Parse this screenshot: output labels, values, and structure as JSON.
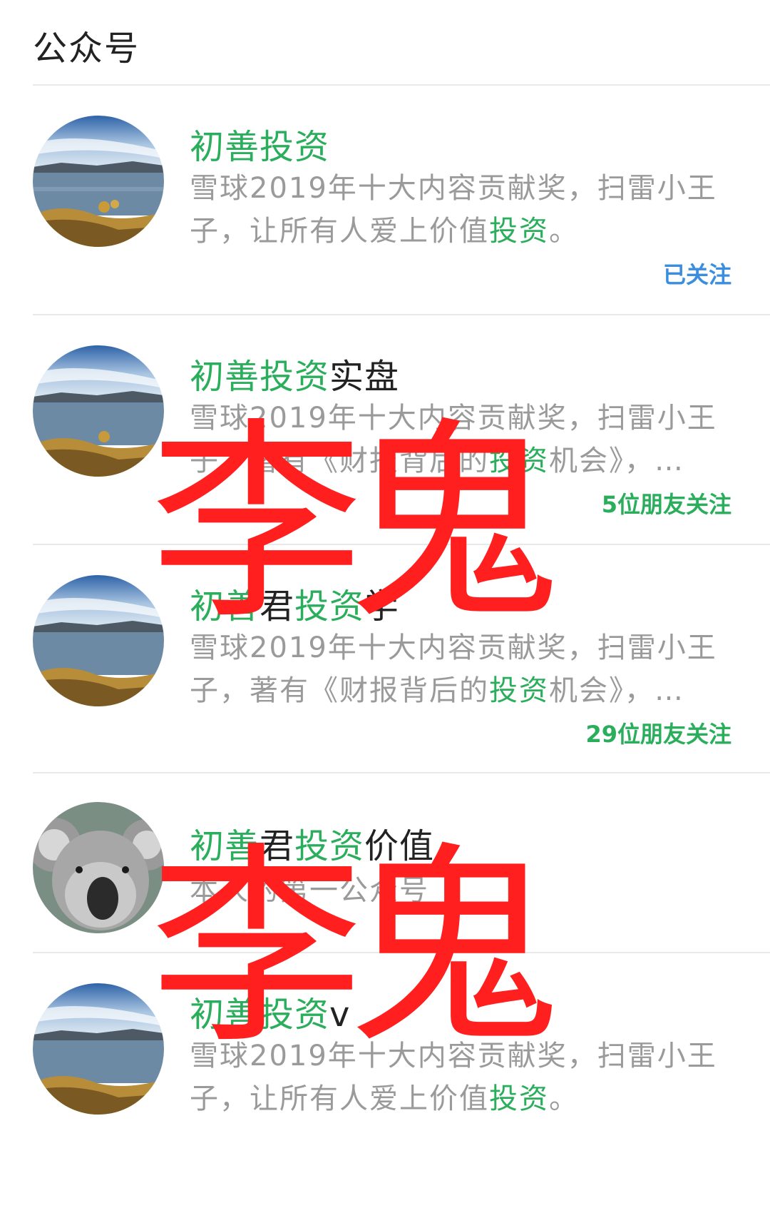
{
  "header": {
    "title": "公众号"
  },
  "accounts": [
    {
      "name_hl": "初善投资",
      "name_rest": "",
      "desc_pre": "雪球2019年十大内容贡献奖，扫雷小王子，让所有人爱上价值",
      "desc_hl": "投资",
      "desc_post": "。",
      "status": "已关注",
      "status_color": "#3b8de0",
      "avatar": "lake-landscape-avatar"
    },
    {
      "name_hl": "初善投资",
      "name_rest": "实盘",
      "desc_pre": "雪球2019年十大内容贡献奖，扫雷小王子，著有《财报背后的",
      "desc_hl": "投资",
      "desc_post": "机会》，…",
      "status": "5位朋友关注",
      "status_color": "#2aae5c",
      "avatar": "lake-landscape-avatar"
    },
    {
      "name_hl": "初善",
      "name_mid": "君",
      "name_hl2": "投资",
      "name_rest": "学",
      "desc_pre": "雪球2019年十大内容贡献奖，扫雷小王子，著有《财报背后的",
      "desc_hl": "投资",
      "desc_post": "机会》，…",
      "status": "29位朋友关注",
      "status_color": "#2aae5c",
      "avatar": "lake-landscape-avatar"
    },
    {
      "name_hl": "初善",
      "name_mid": "君",
      "name_hl2": "投资",
      "name_rest": "价值",
      "desc_pre": "本人的第一公众号",
      "desc_hl": "",
      "desc_post": "",
      "status": "",
      "avatar": "koala-avatar"
    },
    {
      "name_hl": "初善投资",
      "name_rest": "v",
      "desc_pre": "雪球2019年十大内容贡献奖，扫雷小王子，让所有人爱上价值",
      "desc_hl": "投资",
      "desc_post": "。",
      "status": "",
      "avatar": "lake-landscape-avatar"
    }
  ],
  "watermark": {
    "text": "李鬼",
    "color": "#ff1f1f"
  },
  "colors": {
    "highlight": "#2aae5c",
    "followed": "#3b8de0"
  }
}
